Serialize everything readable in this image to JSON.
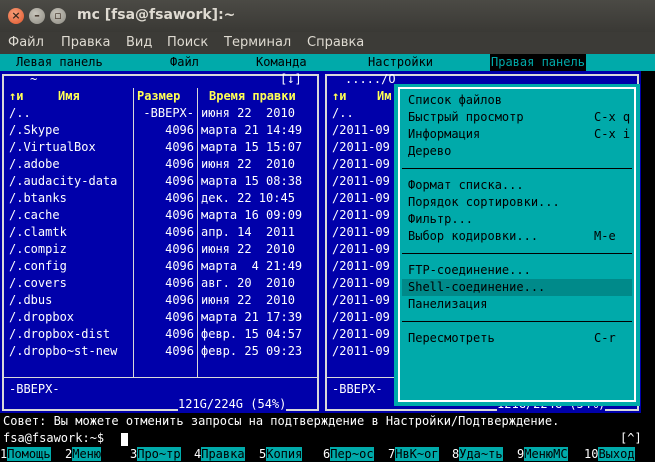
{
  "window": {
    "title": "mc [fsa@fsawork]:~"
  },
  "menubar": [
    "Файл",
    "Правка",
    "Вид",
    "Поиск",
    "Терминал",
    "Справка"
  ],
  "mc_menu": {
    "items": [
      "Левая панель",
      "Файл",
      "Команда",
      "Настройки",
      "Правая панель"
    ],
    "selected": "Правая панель"
  },
  "left_panel": {
    "path": "~",
    "corner": "[↓]",
    "headers": {
      "sort": "↑и",
      "name": "Имя",
      "size": "Размер",
      "time": "Время правки"
    },
    "rows": [
      {
        "name": "/..",
        "size": "-ВВЕРХ-",
        "time": "июня 22  2010"
      },
      {
        "name": "/.Skype",
        "size": "4096",
        "time": "марта 21 14:49"
      },
      {
        "name": "/.VirtualBox",
        "size": "4096",
        "time": "марта 15 15:07"
      },
      {
        "name": "/.adobe",
        "size": "4096",
        "time": "июня 22  2010"
      },
      {
        "name": "/.audacity-data",
        "size": "4096",
        "time": "марта 15 08:38"
      },
      {
        "name": "/.btanks",
        "size": "4096",
        "time": "дек. 22 10:45"
      },
      {
        "name": "/.cache",
        "size": "4096",
        "time": "марта 16 09:09"
      },
      {
        "name": "/.clamtk",
        "size": "4096",
        "time": "апр. 14  2011"
      },
      {
        "name": "/.compiz",
        "size": "4096",
        "time": "июня 22  2010"
      },
      {
        "name": "/.config",
        "size": "4096",
        "time": "марта  4 21:49"
      },
      {
        "name": "/.covers",
        "size": "4096",
        "time": "авг. 20  2010"
      },
      {
        "name": "/.dbus",
        "size": "4096",
        "time": "июня 22  2010"
      },
      {
        "name": "/.dropbox",
        "size": "4096",
        "time": "марта 21 17:39"
      },
      {
        "name": "/.dropbox-dist",
        "size": "4096",
        "time": "февр. 15 04:57"
      },
      {
        "name": "/.dropbo~st-new",
        "size": "4096",
        "time": "февр. 25 09:23"
      }
    ],
    "status": "-ВВЕРХ-",
    "disk": "121G/224G (54%)"
  },
  "right_panel": {
    "path": "...../O",
    "headers": {
      "sort": "↑и",
      "name": "Им"
    },
    "rows": [
      "/..",
      "/2011-09",
      "/2011-09",
      "/2011-09",
      "/2011-09",
      "/2011-09",
      "/2011-09",
      "/2011-09",
      "/2011-09",
      "/2011-09",
      "/2011-09",
      "/2011-09",
      "/2011-09",
      "/2011-09",
      "/2011-09"
    ],
    "status": "-ВВЕРХ-",
    "disk": "121G/224G (54%)"
  },
  "dropdown": {
    "group1": [
      {
        "label": "Список файлов",
        "shortcut": ""
      },
      {
        "label": "Быстрый просмотр",
        "shortcut": "C-x q"
      },
      {
        "label": "Информация",
        "shortcut": "C-x i"
      },
      {
        "label": "Дерево",
        "shortcut": ""
      }
    ],
    "group2": [
      {
        "label": "Формат списка...",
        "shortcut": ""
      },
      {
        "label": "Порядок сортировки...",
        "shortcut": ""
      },
      {
        "label": "Фильтр...",
        "shortcut": ""
      },
      {
        "label": "Выбор кодировки...",
        "shortcut": "M-e"
      }
    ],
    "group3": [
      {
        "label": "FTP-соединение...",
        "shortcut": ""
      },
      {
        "label": "Shell-соединение...",
        "shortcut": ""
      },
      {
        "label": "Панелизация",
        "shortcut": ""
      }
    ],
    "group4": [
      {
        "label": "Пересмотреть",
        "shortcut": "C-r"
      }
    ],
    "highlighted": "Shell-соединение..."
  },
  "hint": "Совет: Вы можете отменить запросы на подтверждение в Настройки/Подтверждение.",
  "prompt": "fsa@fsawork:~$",
  "prompt_corner": "[^]",
  "fkeys": [
    {
      "n": "1",
      "label": "Помощь"
    },
    {
      "n": "2",
      "label": "Меню"
    },
    {
      "n": "3",
      "label": "Про~тр"
    },
    {
      "n": "4",
      "label": "Правка"
    },
    {
      "n": "5",
      "label": "Копия"
    },
    {
      "n": "6",
      "label": "Пер~ос"
    },
    {
      "n": "7",
      "label": "НвК~ог"
    },
    {
      "n": "8",
      "label": "Уда~ть"
    },
    {
      "n": "9",
      "label": "МенюMC"
    },
    {
      "n": "10",
      "label": "Выход"
    }
  ]
}
